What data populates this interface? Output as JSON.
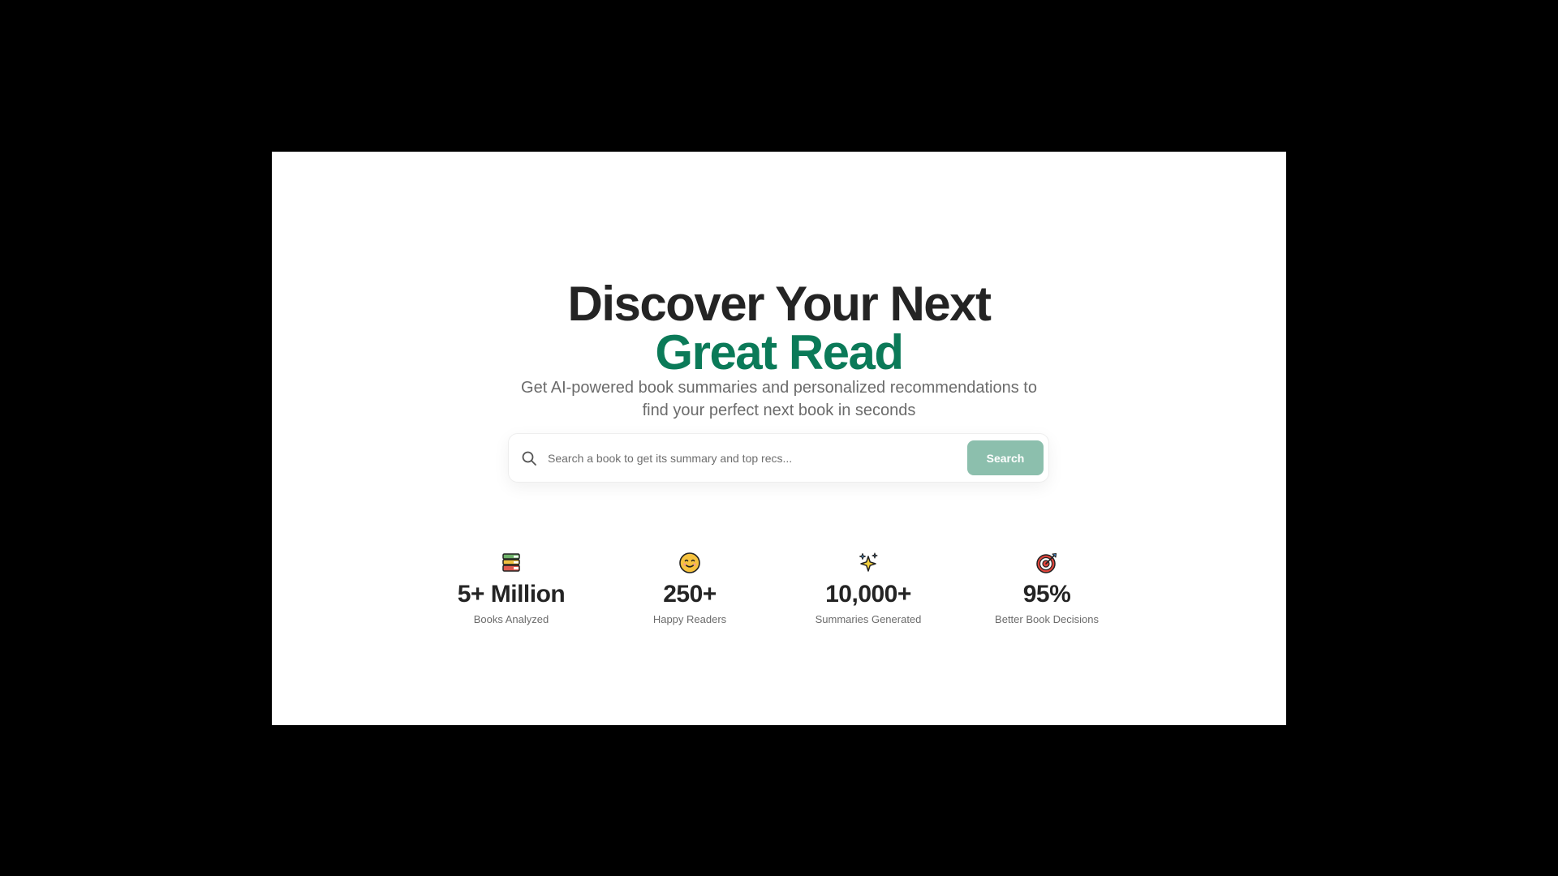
{
  "hero": {
    "title_line_1": "Discover Your Next",
    "title_line_2": "Great Read",
    "subtitle": "Get AI-powered book summaries and personalized recommendations to find your perfect next book in seconds"
  },
  "search": {
    "placeholder": "Search a book to get its summary and top recs...",
    "value": "",
    "button_label": "Search"
  },
  "stats": [
    {
      "icon": "books-icon",
      "value": "5+ Million",
      "label": "Books Analyzed"
    },
    {
      "icon": "smiley-icon",
      "value": "250+",
      "label": "Happy Readers"
    },
    {
      "icon": "sparkles-icon",
      "value": "10,000+",
      "label": "Summaries Generated"
    },
    {
      "icon": "target-icon",
      "value": "95%",
      "label": "Better Book Decisions"
    }
  ],
  "colors": {
    "accent": "#0b7a58",
    "button": "#8cbfad",
    "heading": "#242424",
    "muted": "#6b6b6b",
    "backdrop": "#000000",
    "panel": "#ffffff"
  }
}
